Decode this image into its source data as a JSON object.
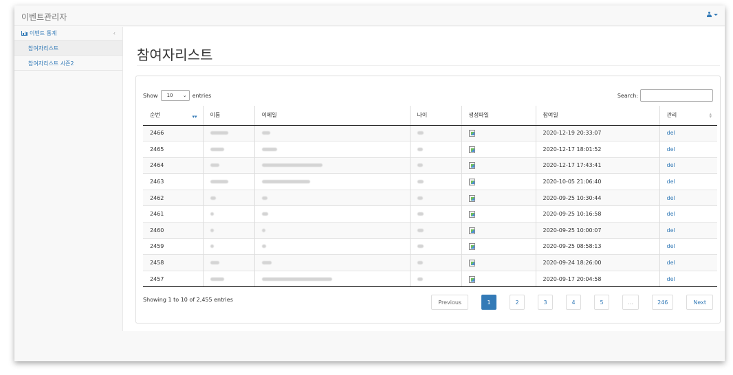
{
  "app": {
    "title": "이벤트관리자"
  },
  "sidebar": {
    "group_label": "이벤트 통계",
    "collapse_glyph": "‹",
    "items": [
      {
        "label": "참여자리스트",
        "active": true
      },
      {
        "label": "참여자리스트 시즌2",
        "active": false
      }
    ]
  },
  "page": {
    "title": "참여자리스트"
  },
  "table_controls": {
    "show_label": "Show",
    "length_value": "10",
    "entries_label": "entries",
    "search_label": "Search:"
  },
  "table": {
    "columns": [
      "순번",
      "이름",
      "이메일",
      "나이",
      "생성파일",
      "참여일",
      "관리"
    ],
    "rows": [
      {
        "no": "2466",
        "date": "2020-12-19 20:33:07",
        "action": "del"
      },
      {
        "no": "2465",
        "date": "2020-12-17 18:01:52",
        "action": "del"
      },
      {
        "no": "2464",
        "date": "2020-12-17 17:43:41",
        "action": "del"
      },
      {
        "no": "2463",
        "date": "2020-10-05 21:06:40",
        "action": "del"
      },
      {
        "no": "2462",
        "date": "2020-09-25 10:30:44",
        "action": "del"
      },
      {
        "no": "2461",
        "date": "2020-09-25 10:16:58",
        "action": "del"
      },
      {
        "no": "2460",
        "date": "2020-09-25 10:00:07",
        "action": "del"
      },
      {
        "no": "2459",
        "date": "2020-09-25 08:58:13",
        "action": "del"
      },
      {
        "no": "2458",
        "date": "2020-09-24 18:26:00",
        "action": "del"
      },
      {
        "no": "2457",
        "date": "2020-09-17 20:04:58",
        "action": "del"
      }
    ]
  },
  "info": "Showing 1 to 10 of 2,455 entries",
  "pagination": {
    "previous": "Previous",
    "pages": [
      "1",
      "2",
      "3",
      "4",
      "5",
      "…",
      "246"
    ],
    "current": "1",
    "next": "Next"
  },
  "colors": {
    "accent": "#337ab7",
    "navbar": "#f8f8f8"
  }
}
